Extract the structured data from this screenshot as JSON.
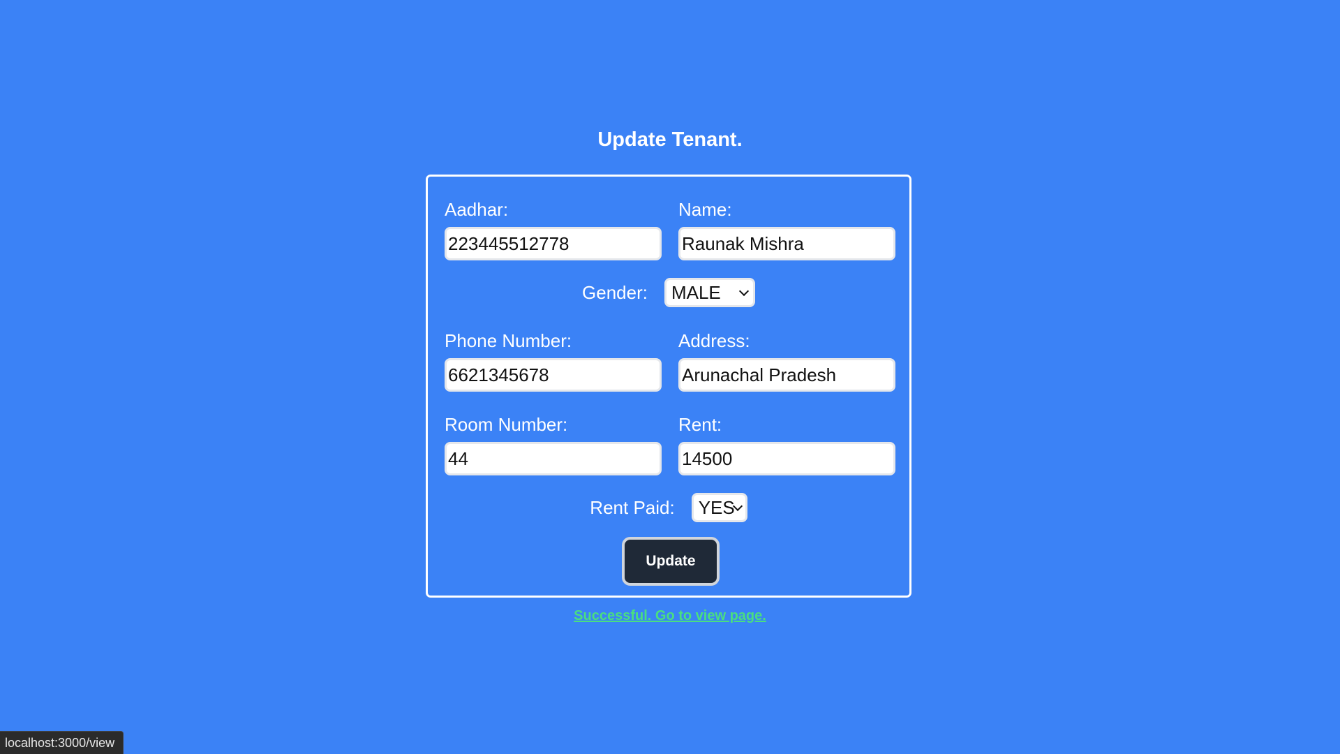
{
  "page": {
    "title": "Update Tenant."
  },
  "form": {
    "aadhar": {
      "label": "Aadhar:",
      "value": "223445512778"
    },
    "name": {
      "label": "Name:",
      "value": "Raunak Mishra"
    },
    "gender": {
      "label": "Gender:",
      "value": "MALE"
    },
    "phone": {
      "label": "Phone Number:",
      "value": "6621345678"
    },
    "address": {
      "label": "Address:",
      "value": "Arunachal Pradesh"
    },
    "room": {
      "label": "Room Number:",
      "value": "44"
    },
    "rent": {
      "label": "Rent:",
      "value": "14500"
    },
    "rent_paid": {
      "label": "Rent Paid:",
      "value": "YES"
    },
    "submit_label": "Update"
  },
  "status": {
    "message": "Successful. Go to view page.",
    "hover_url": "localhost:3000/view"
  },
  "colors": {
    "background": "#3b82f6",
    "button": "#1f2937",
    "success": "#4ade80"
  }
}
